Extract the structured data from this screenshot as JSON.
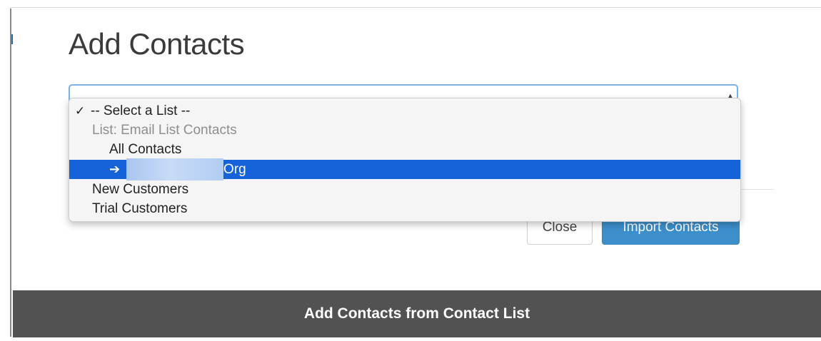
{
  "modal": {
    "title": "Add Contacts",
    "buttons": {
      "close_label": "Close",
      "import_label": "Import Contacts"
    }
  },
  "list_select": {
    "selected": "-- Select a List --",
    "options": [
      {
        "label": "-- Select a List --",
        "checked": true
      },
      {
        "label": "List: Email List Contacts",
        "group_header": true
      },
      {
        "label": "All Contacts"
      },
      {
        "label": "Org",
        "highlighted": true,
        "icon": "arrow-right-icon"
      },
      {
        "label": "New Customers"
      },
      {
        "label": "Trial Customers"
      }
    ]
  },
  "footer": {
    "title": "Add Contacts from Contact List"
  },
  "colors": {
    "accent": "#3d8fcc",
    "highlight": "#1662d8",
    "footer_bg": "#525252",
    "focus_border": "#7eb0e3"
  }
}
